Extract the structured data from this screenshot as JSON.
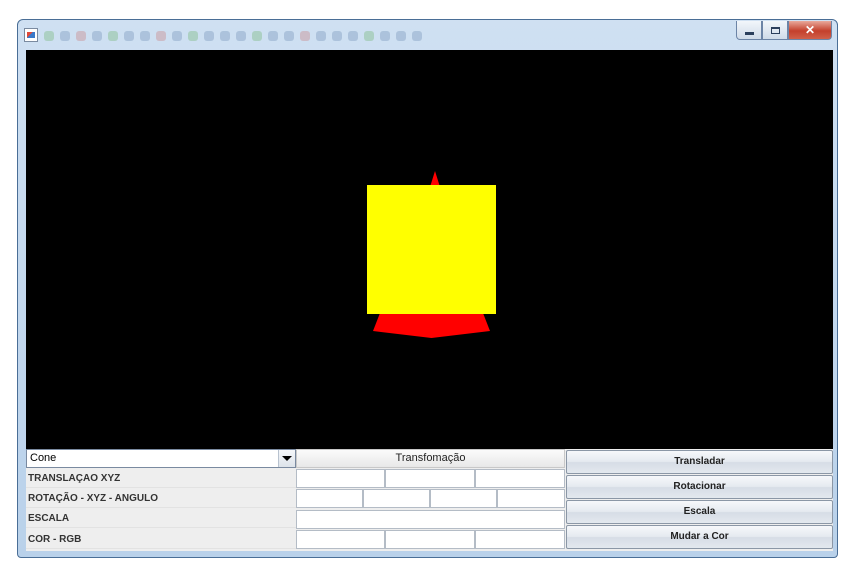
{
  "window": {
    "controls": {
      "minimize": "minimize-button",
      "maximize": "maximize-button",
      "close": "✕"
    }
  },
  "scene": {
    "colors": {
      "background": "#000000",
      "cube": "#ffff00",
      "cone": "#ff0000"
    }
  },
  "panel": {
    "shape_select": {
      "selected": "Cone"
    },
    "transform_header": "Transfomação",
    "rows": [
      {
        "label": "TRANSLAÇAO XYZ",
        "fields": [
          "",
          "",
          ""
        ]
      },
      {
        "label": "ROTAÇÃO - XYZ - ANGULO",
        "fields": [
          "",
          "",
          "",
          ""
        ]
      },
      {
        "label": "ESCALA",
        "fields": [
          ""
        ]
      },
      {
        "label": "COR - RGB",
        "fields": [
          "",
          "",
          ""
        ]
      }
    ],
    "buttons": {
      "translate": "Transladar",
      "rotate": "Rotacionar",
      "scale": "Escala",
      "color": "Mudar a Cor"
    }
  }
}
